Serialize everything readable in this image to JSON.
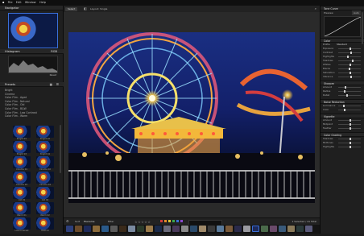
{
  "menubar": {
    "items": [
      "File",
      "Edit",
      "Window",
      "Help"
    ]
  },
  "left": {
    "navigator_title": "Navigator",
    "histogram_title": "Histogram",
    "histogram_value": "RGB",
    "reset_label": "Reset",
    "presets_title": "Presets",
    "preset_list": [
      "Bright",
      "Cinema",
      "Color Film - Aged",
      "Color Film - Natural",
      "Color Film - Old",
      "Color Film - B&W",
      "Color Film - Low Contrast",
      "Color Film - Warm"
    ],
    "thumbs": [
      "Bright 01",
      "Bright 02",
      "Bright 03",
      "Bright 04",
      "Cinema 01",
      "Cinema 02",
      "Cinema 03",
      "Cinema 04",
      "Old 01",
      "Old 02",
      "Warm 01",
      "Warm 02",
      "Low Contrast",
      "HDR 01"
    ]
  },
  "toolbar": {
    "select_label": "Select",
    "layout_label": "Layout: Single"
  },
  "bottom": {
    "sort_label": "Sort",
    "sort_value": "Filename",
    "filter_label": "Filter",
    "stars": "☆☆☆☆☆",
    "status": "1 Selected / 41 Total"
  },
  "right": {
    "tone_title": "Tone Curve",
    "preview_label": "Preview",
    "auto_label": "Auto",
    "color_label": "Color",
    "mode_label": "Profile",
    "mode_value": "Standard",
    "sliders": [
      "Exposure",
      "Contrast",
      "Highlights",
      "Shadows",
      "Whites",
      "Blacks",
      "Saturation",
      "Vibrance"
    ],
    "sec2": "Sharpen",
    "sec2_sliders": [
      "Amount",
      "Radius",
      "Detail"
    ],
    "sec3": "Noise Reduction",
    "sec3_sliders": [
      "Luminance",
      "Color"
    ],
    "sec4": "Vignette",
    "sec4_sliders": [
      "Amount",
      "Midpoint",
      "Feather"
    ],
    "sec5": "Color Grading",
    "sec5_sliders": [
      "Shadows",
      "Midtones",
      "Highlights"
    ]
  },
  "colors": {
    "accent": "#3a6fd8",
    "bg": "#1b1b1b",
    "panel": "#1f1f1f"
  }
}
